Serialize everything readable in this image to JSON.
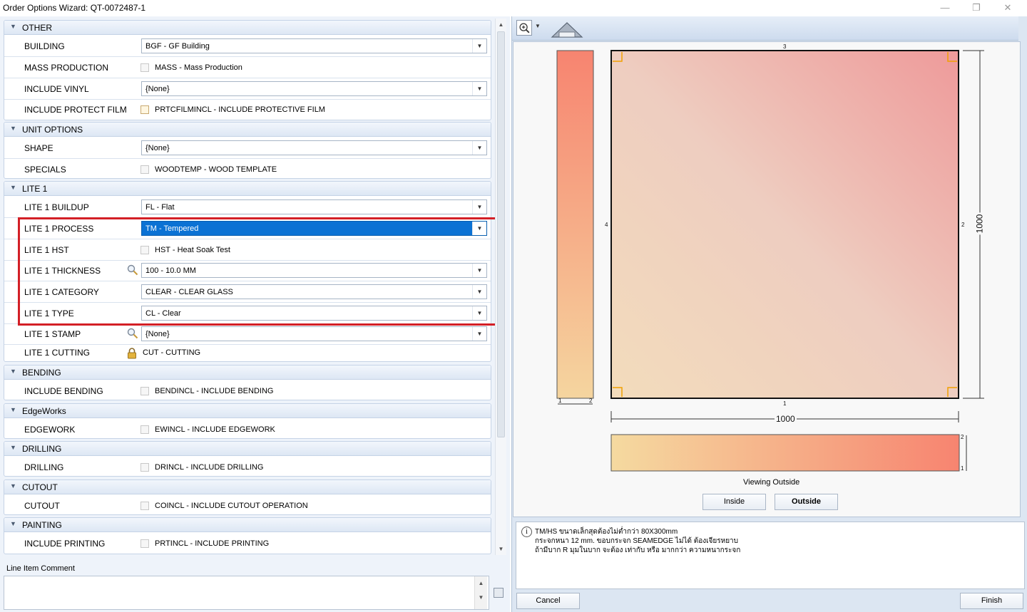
{
  "window": {
    "title": "Order Options Wizard: QT-0072487-1",
    "minimize_glyph": "—",
    "restore_glyph": "❐",
    "close_glyph": "✕"
  },
  "groups": {
    "other": {
      "title": "OTHER",
      "building": {
        "label": "BUILDING",
        "value": "BGF - GF Building"
      },
      "mass_production": {
        "label": "MASS PRODUCTION",
        "option": "MASS - Mass Production",
        "checked": false
      },
      "include_vinyl": {
        "label": "INCLUDE VINYL",
        "value": "{None}"
      },
      "include_protect_film": {
        "label": "INCLUDE PROTECT FILM",
        "option": "PRTCFILMINCL - INCLUDE PROTECTIVE FILM",
        "checked": false
      }
    },
    "unit_options": {
      "title": "UNIT OPTIONS",
      "shape": {
        "label": "SHAPE",
        "value": "{None}"
      },
      "specials": {
        "label": "SPECIALS",
        "option": "WOODTEMP - WOOD TEMPLATE",
        "checked": false
      }
    },
    "lite1": {
      "title": "LITE 1",
      "buildup": {
        "label": "LITE 1 BUILDUP",
        "value": "FL - Flat"
      },
      "process": {
        "label": "LITE 1 PROCESS",
        "value": "TM - Tempered"
      },
      "hst": {
        "label": "LITE 1 HST",
        "option": "HST - Heat Soak Test",
        "checked": false
      },
      "thickness": {
        "label": "LITE 1 THICKNESS",
        "value": "100 - 10.0 MM"
      },
      "category": {
        "label": "LITE 1 CATEGORY",
        "value": "CLEAR - CLEAR GLASS"
      },
      "type": {
        "label": "LITE 1 TYPE",
        "value": "CL - Clear"
      },
      "stamp": {
        "label": "LITE 1 STAMP",
        "value": "{None}"
      },
      "cutting": {
        "label": "LITE 1 CUTTING",
        "option": "CUT - CUTTING"
      }
    },
    "bending": {
      "title": "BENDING",
      "include_bending": {
        "label": "INCLUDE BENDING",
        "option": "BENDINCL - INCLUDE BENDING",
        "checked": false
      }
    },
    "edgeworks": {
      "title": "EdgeWorks",
      "edgework": {
        "label": "EDGEWORK",
        "option": "EWINCL - INCLUDE EDGEWORK",
        "checked": false
      }
    },
    "drilling": {
      "title": "DRILLING",
      "drilling": {
        "label": "DRILLING",
        "option": "DRINCL - INCLUDE DRILLING",
        "checked": false
      }
    },
    "cutout": {
      "title": "CUTOUT",
      "cutout": {
        "label": "CUTOUT",
        "option": "COINCL - INCLUDE CUTOUT OPERATION",
        "checked": false
      }
    },
    "painting": {
      "title": "PAINTING",
      "include_printing": {
        "label": "INCLUDE PRINTING",
        "option": "PRTINCL - INCLUDE PRINTING",
        "checked": false
      }
    }
  },
  "comment": {
    "label": "Line Item Comment",
    "value": ""
  },
  "icons": {
    "caret": "▼",
    "combo_arrow": "▼",
    "scroll_up": "▲",
    "scroll_down": "▼",
    "info": "i"
  },
  "preview": {
    "width_dim": "1000",
    "height_dim": "1000",
    "edge_top": "3",
    "edge_bottom": "1",
    "edge_left": "4",
    "edge_right": "2",
    "side_strip_a": "1",
    "side_strip_b": "2",
    "bottom_strip_a": "2",
    "bottom_strip_b": "1",
    "viewing": "Viewing Outside",
    "inside_button": "Inside",
    "outside_button": "Outside"
  },
  "info": {
    "line1": "TM/HS ขนาดเล็กสุดต้องไม่ต่ำกว่า 80X300mm",
    "line2": "กระจกหนา 12 mm. ขอบกระจก SEAMEDGE ไม่ได้ ต้องเจียรหยาบ",
    "line3": "ถ้ามีบาก R มุมในบาก จะต้อง เท่ากับ หรือ มากกว่า ความหนากระจก"
  },
  "footer": {
    "cancel": "Cancel",
    "finish": "Finish"
  },
  "colors": {
    "selection": "#0b72d4",
    "highlight_frame": "#d31f26",
    "corner_marker": "#f0a000",
    "glass_gradient_start": "#f7d59a",
    "glass_gradient_end": "#f7806a"
  }
}
